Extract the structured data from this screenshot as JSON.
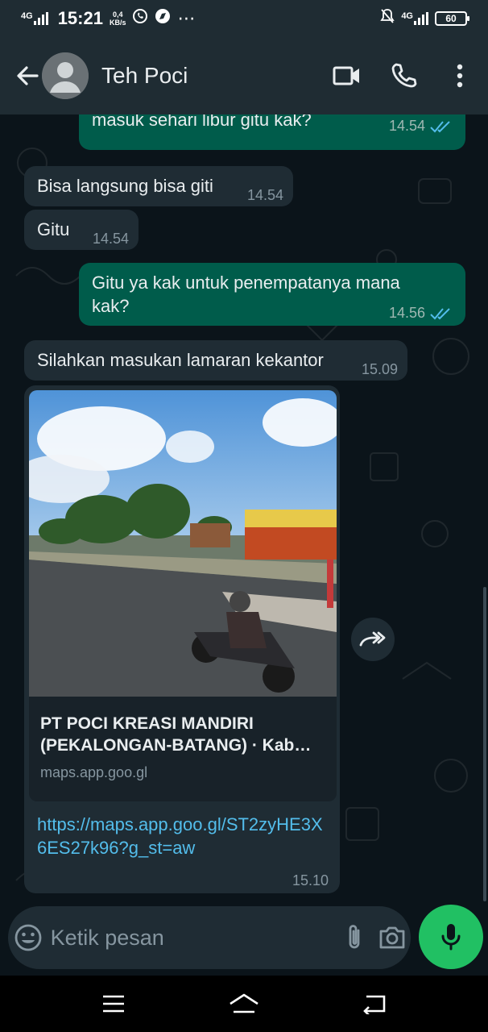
{
  "status_bar": {
    "network_left": "4G",
    "time": "15:21",
    "speed_value": "0,4",
    "speed_unit": "KB/s",
    "extra_icons": "⋯",
    "network_right": "4G",
    "battery": "60"
  },
  "header": {
    "contact_name": "Teh Poci"
  },
  "messages": [
    {
      "dir": "out",
      "text": "masuk sehari libur gitu kak?",
      "time": "14.54",
      "read": true
    },
    {
      "dir": "in",
      "text": "Bisa langsung bisa giti",
      "time": "14.54"
    },
    {
      "dir": "in",
      "text": "Gitu",
      "time": "14.54"
    },
    {
      "dir": "out",
      "text": "Gitu ya kak untuk penempatanya mana kak?",
      "time": "14.56",
      "read": true
    },
    {
      "dir": "in",
      "text": "Silahkan masukan lamaran kekantor",
      "time": "15.09"
    },
    {
      "dir": "in",
      "preview_title": "PT POCI KREASI MANDIRI (PEKALONGAN-BATANG) · Kab…",
      "preview_domain": "maps.app.goo.gl",
      "link": "https://maps.app.goo.gl/ST2zyHE3X6ES27k96?g_st=aw",
      "time": "15.10"
    }
  ],
  "input": {
    "placeholder": "Ketik pesan"
  },
  "colors": {
    "chat_bg": "#0b141a",
    "header_bg": "#1f2c33",
    "outgoing_bubble": "#005c4b",
    "incoming_bubble": "#1f2c34",
    "link": "#53bdeb",
    "read_ticks": "#53bdeb",
    "mic_button": "#21c063"
  },
  "icons": {
    "back": "arrow-left-icon",
    "video_call": "video-camera-icon",
    "voice_call": "phone-icon",
    "menu": "more-vertical-icon",
    "forward": "forward-icon",
    "emoji": "emoji-icon",
    "attach": "paperclip-icon",
    "camera": "camera-icon",
    "mic": "microphone-icon"
  }
}
